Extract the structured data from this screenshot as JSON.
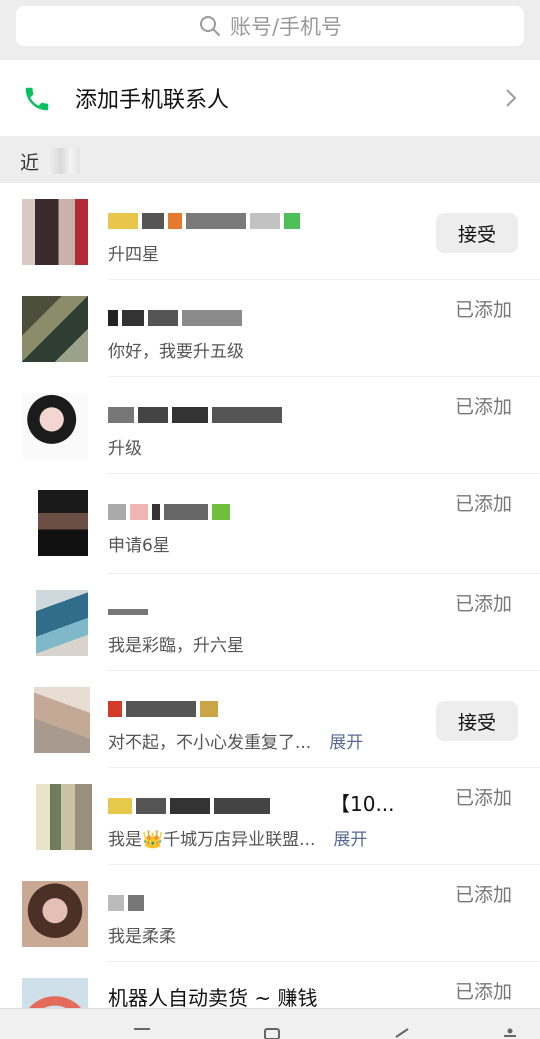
{
  "search": {
    "placeholder": "账号/手机号"
  },
  "add_phone_contacts": {
    "label": "添加手机联系人"
  },
  "section": {
    "title": "近"
  },
  "requests": [
    {
      "name": "",
      "name_suffix": "",
      "message": "升四星",
      "action": "接受",
      "state": "pending"
    },
    {
      "name": "",
      "message": "你好，我要升五级",
      "action": "已添加",
      "state": "added"
    },
    {
      "name": "",
      "message": "升级",
      "action": "已添加",
      "state": "added"
    },
    {
      "name": "",
      "message": "申请6星",
      "action": "已添加",
      "state": "added"
    },
    {
      "name": "",
      "message": "我是彩臨，升六星",
      "action": "已添加",
      "state": "added"
    },
    {
      "name": "",
      "message": "对不起，不小心发重复了...",
      "expand": "展开",
      "action": "接受",
      "state": "pending"
    },
    {
      "name": "【10...",
      "message": "我是👑千城万店异业联盟...",
      "expand": "展开",
      "action": "已添加",
      "state": "added"
    },
    {
      "name": "",
      "message": "我是柔柔",
      "action": "已添加",
      "state": "added"
    },
    {
      "name": "机器人自动卖货 ~ 赚钱",
      "message": "",
      "action": "已添加",
      "state": "added"
    }
  ],
  "colors": {
    "accent_green": "#07c160",
    "link_blue": "#576b95",
    "page_bg": "#ededed"
  }
}
